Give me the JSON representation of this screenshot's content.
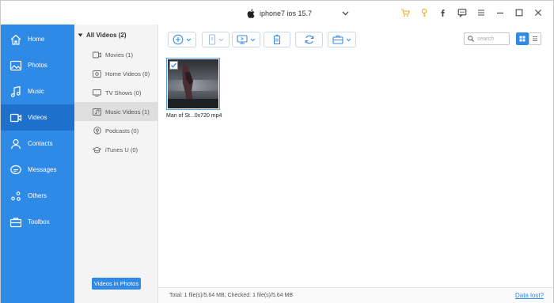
{
  "titlebar": {
    "device_name": "iphone7 ios 15.7",
    "icons": [
      "cart-icon",
      "key-icon",
      "facebook-icon",
      "feedback-icon",
      "menu-icon",
      "minimize-icon",
      "maximize-icon",
      "close-icon"
    ],
    "accent_color": "#f5a623"
  },
  "sidebar": {
    "bg_color": "#2f8ae6",
    "active_color": "#1f6fcc",
    "items": [
      {
        "label": "Home",
        "icon": "home-icon"
      },
      {
        "label": "Photos",
        "icon": "photos-icon"
      },
      {
        "label": "Music",
        "icon": "music-icon"
      },
      {
        "label": "Videos",
        "icon": "videos-icon",
        "active": true
      },
      {
        "label": "Contacts",
        "icon": "contacts-icon"
      },
      {
        "label": "Messages",
        "icon": "messages-icon"
      },
      {
        "label": "Others",
        "icon": "others-icon"
      },
      {
        "label": "Toolbox",
        "icon": "toolbox-icon"
      }
    ]
  },
  "categories": {
    "header": "All Videos (2)",
    "items": [
      {
        "label": "Movies (1)",
        "icon": "movie-icon"
      },
      {
        "label": "Home Videos (0)",
        "icon": "home-video-icon"
      },
      {
        "label": "TV Shows (0)",
        "icon": "tv-icon"
      },
      {
        "label": "Music Videos (1)",
        "icon": "music-video-icon",
        "active": true
      },
      {
        "label": "Podcasts (0)",
        "icon": "podcast-icon"
      },
      {
        "label": "iTunes U (0)",
        "icon": "itunes-u-icon"
      }
    ],
    "videos_in_photos_button": "Videos in Photos"
  },
  "toolbar": {
    "buttons": [
      "add-icon",
      "export-device-icon",
      "export-pc-icon",
      "delete-icon",
      "refresh-icon",
      "toolkit-icon"
    ],
    "search_placeholder": "search"
  },
  "content": {
    "items": [
      {
        "caption": "Man of St...0x720 mp4",
        "checked": true
      }
    ]
  },
  "status": {
    "summary": "Total: 1 file(s)/5.64 MB; Checked: 1 file(s)/5.64 MB",
    "data_lost_link": "Data lost?"
  }
}
